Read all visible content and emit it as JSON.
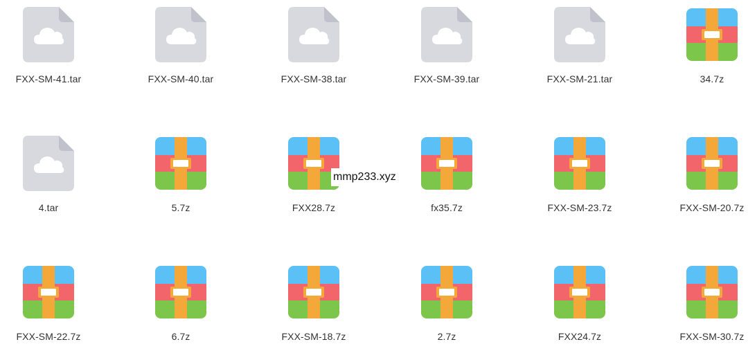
{
  "colors": {
    "cloud_file_bg": "#d7d9df",
    "cloud_file_fold": "#bfc2ca",
    "cloud_glyph": "#ffffff",
    "archive_top": "#5bc0f5",
    "archive_middle": "#f2666b",
    "archive_bottom": "#7cc64b",
    "archive_strap": "#f5a83a",
    "archive_label": "#ffffff",
    "text": "#333333"
  },
  "files": [
    {
      "name": "FXX-SM-41.tar",
      "icon": "cloud-file-icon"
    },
    {
      "name": "FXX-SM-40.tar",
      "icon": "cloud-file-icon"
    },
    {
      "name": "FXX-SM-38.tar",
      "icon": "cloud-file-icon"
    },
    {
      "name": "FXX-SM-39.tar",
      "icon": "cloud-file-icon"
    },
    {
      "name": "FXX-SM-21.tar",
      "icon": "cloud-file-icon"
    },
    {
      "name": "34.7z",
      "icon": "archive-icon"
    },
    {
      "name": "4.tar",
      "icon": "cloud-file-icon"
    },
    {
      "name": "5.7z",
      "icon": "archive-icon"
    },
    {
      "name": "FXX28.7z",
      "icon": "archive-icon"
    },
    {
      "name": "fx35.7z",
      "icon": "archive-icon"
    },
    {
      "name": "FXX-SM-23.7z",
      "icon": "archive-icon"
    },
    {
      "name": "FXX-SM-20.7z",
      "icon": "archive-icon"
    },
    {
      "name": "FXX-SM-22.7z",
      "icon": "archive-icon"
    },
    {
      "name": "6.7z",
      "icon": "archive-icon"
    },
    {
      "name": "FXX-SM-18.7z",
      "icon": "archive-icon"
    },
    {
      "name": "2.7z",
      "icon": "archive-icon"
    },
    {
      "name": "FXX24.7z",
      "icon": "archive-icon"
    },
    {
      "name": "FXX-SM-30.7z",
      "icon": "archive-icon"
    }
  ],
  "watermark": "mmp233.xyz"
}
